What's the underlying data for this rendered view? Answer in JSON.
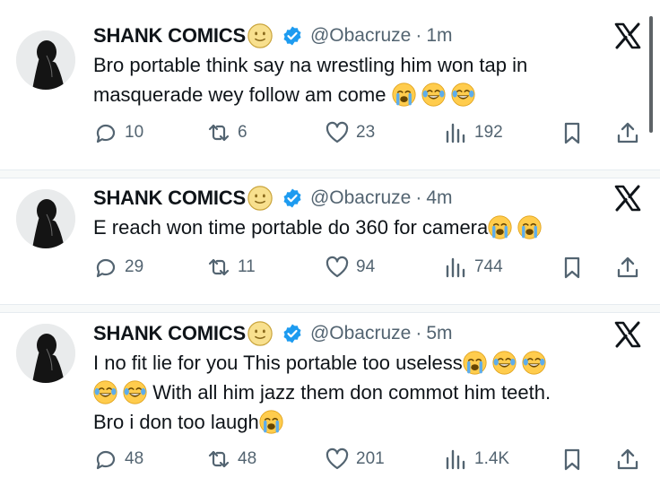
{
  "tweets": [
    {
      "name": "SHANK COMICS",
      "handle": "@Obacruze",
      "sep": "·",
      "time": "1m",
      "text_lines": [
        "Bro portable think say na wrestling him won tap in",
        "masquerade wey follow am come"
      ],
      "counts": {
        "replies": "10",
        "reposts": "6",
        "likes": "23",
        "views": "192"
      }
    },
    {
      "name": "SHANK COMICS",
      "handle": "@Obacruze",
      "sep": "·",
      "time": "4m",
      "text_lines": [
        "E reach won time portable do 360 for camera"
      ],
      "counts": {
        "replies": "29",
        "reposts": "11",
        "likes": "94",
        "views": "744"
      }
    },
    {
      "name": "SHANK COMICS",
      "handle": "@Obacruze",
      "sep": "·",
      "time": "5m",
      "text_lines": [
        "I no fit lie for you This portable too useless",
        "With all him jazz them don commot him teeth.",
        "Bro i don too laugh"
      ],
      "counts": {
        "replies": "48",
        "reposts": "48",
        "likes": "201",
        "views": "1.4K"
      }
    }
  ],
  "icons": {
    "header_emoji": "slightly-smiling-face-emoji",
    "verified": "verified-badge-icon",
    "platform": "x-logo-icon",
    "reply": "reply-icon",
    "repost": "repost-icon",
    "like": "heart-icon",
    "views": "views-icon",
    "bookmark": "bookmark-icon",
    "share": "share-icon",
    "crying": "loudly-crying-face-emoji",
    "laughing": "tears-of-joy-emoji"
  },
  "colors": {
    "verified": "#1d9bf0",
    "muted": "#536471",
    "text": "#0f1419"
  }
}
